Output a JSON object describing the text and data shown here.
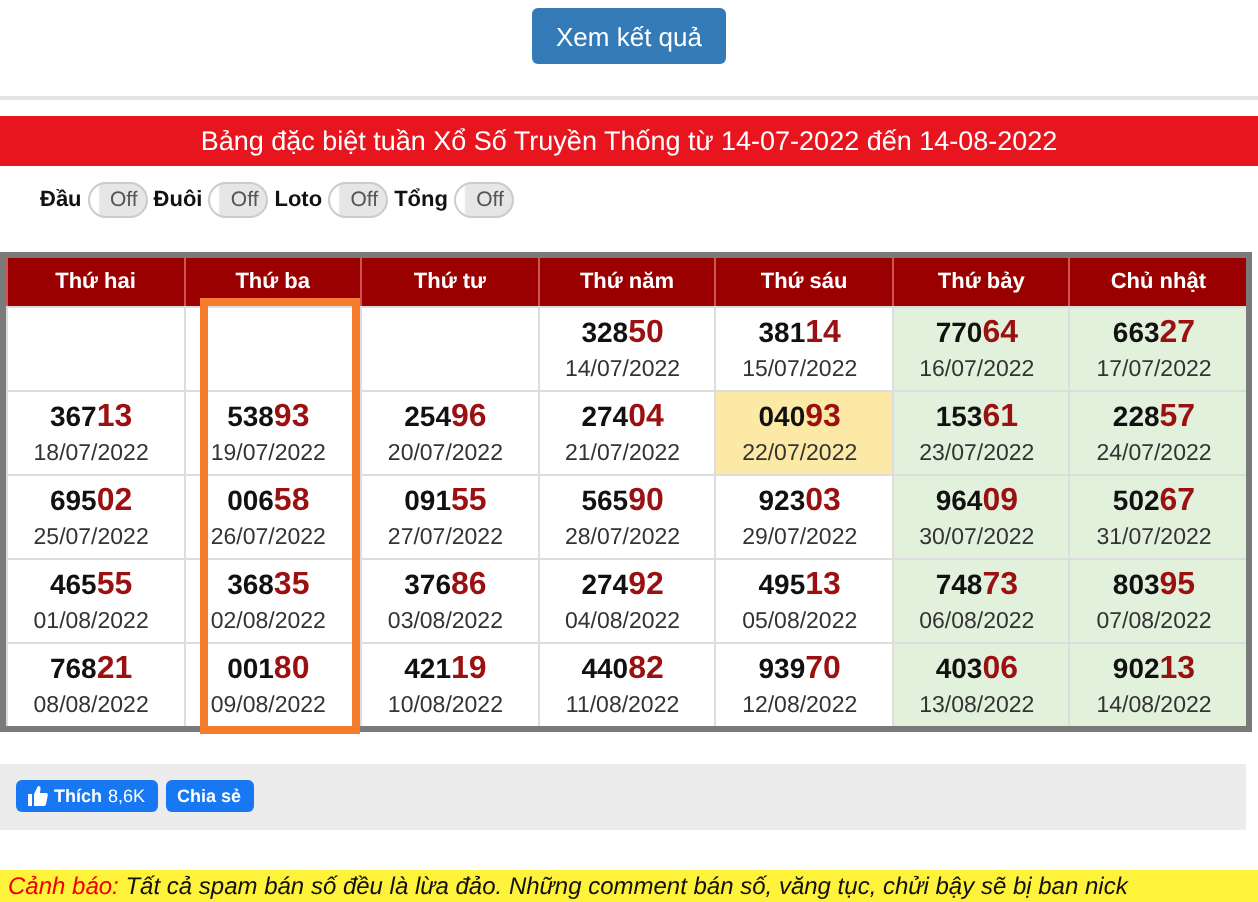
{
  "submit_button": {
    "label": "Xem kết quả"
  },
  "banner": {
    "title": "Bảng đặc biệt tuần Xổ Số Truyền Thống từ 14-07-2022 đến 14-08-2022"
  },
  "toggles": [
    {
      "label": "Đầu",
      "text": "Off",
      "on": false
    },
    {
      "label": "Đuôi",
      "text": "Off",
      "on": false
    },
    {
      "label": "Loto",
      "text": "Off",
      "on": false
    },
    {
      "label": "Tổng",
      "text": "Off",
      "on": false
    }
  ],
  "table": {
    "columns": [
      {
        "label": "Thứ hai",
        "weekend": false,
        "marked": false
      },
      {
        "label": "Thứ ba",
        "weekend": false,
        "marked": true
      },
      {
        "label": "Thứ tư",
        "weekend": false,
        "marked": false
      },
      {
        "label": "Thứ năm",
        "weekend": false,
        "marked": false
      },
      {
        "label": "Thứ sáu",
        "weekend": false,
        "marked": false
      },
      {
        "label": "Thứ bảy",
        "weekend": true,
        "marked": false
      },
      {
        "label": "Chủ nhật",
        "weekend": true,
        "marked": false
      }
    ],
    "rows": [
      [
        {
          "empty": true
        },
        {
          "empty": true
        },
        {
          "empty": true
        },
        {
          "head": "328",
          "tail": "50",
          "date": "14/07/2022",
          "highlighted": false
        },
        {
          "head": "381",
          "tail": "14",
          "date": "15/07/2022",
          "highlighted": false
        },
        {
          "head": "770",
          "tail": "64",
          "date": "16/07/2022",
          "highlighted": false
        },
        {
          "head": "663",
          "tail": "27",
          "date": "17/07/2022",
          "highlighted": false
        }
      ],
      [
        {
          "head": "367",
          "tail": "13",
          "date": "18/07/2022",
          "highlighted": false
        },
        {
          "head": "538",
          "tail": "93",
          "date": "19/07/2022",
          "highlighted": false
        },
        {
          "head": "254",
          "tail": "96",
          "date": "20/07/2022",
          "highlighted": false
        },
        {
          "head": "274",
          "tail": "04",
          "date": "21/07/2022",
          "highlighted": false
        },
        {
          "head": "040",
          "tail": "93",
          "date": "22/07/2022",
          "highlighted": true
        },
        {
          "head": "153",
          "tail": "61",
          "date": "23/07/2022",
          "highlighted": false
        },
        {
          "head": "228",
          "tail": "57",
          "date": "24/07/2022",
          "highlighted": false
        }
      ],
      [
        {
          "head": "695",
          "tail": "02",
          "date": "25/07/2022",
          "highlighted": false
        },
        {
          "head": "006",
          "tail": "58",
          "date": "26/07/2022",
          "highlighted": false
        },
        {
          "head": "091",
          "tail": "55",
          "date": "27/07/2022",
          "highlighted": false
        },
        {
          "head": "565",
          "tail": "90",
          "date": "28/07/2022",
          "highlighted": false
        },
        {
          "head": "923",
          "tail": "03",
          "date": "29/07/2022",
          "highlighted": false
        },
        {
          "head": "964",
          "tail": "09",
          "date": "30/07/2022",
          "highlighted": false
        },
        {
          "head": "502",
          "tail": "67",
          "date": "31/07/2022",
          "highlighted": false
        }
      ],
      [
        {
          "head": "465",
          "tail": "55",
          "date": "01/08/2022",
          "highlighted": false
        },
        {
          "head": "368",
          "tail": "35",
          "date": "02/08/2022",
          "highlighted": false
        },
        {
          "head": "376",
          "tail": "86",
          "date": "03/08/2022",
          "highlighted": false
        },
        {
          "head": "274",
          "tail": "92",
          "date": "04/08/2022",
          "highlighted": false
        },
        {
          "head": "495",
          "tail": "13",
          "date": "05/08/2022",
          "highlighted": false
        },
        {
          "head": "748",
          "tail": "73",
          "date": "06/08/2022",
          "highlighted": false
        },
        {
          "head": "803",
          "tail": "95",
          "date": "07/08/2022",
          "highlighted": false
        }
      ],
      [
        {
          "head": "768",
          "tail": "21",
          "date": "08/08/2022",
          "highlighted": false
        },
        {
          "head": "001",
          "tail": "80",
          "date": "09/08/2022",
          "highlighted": false
        },
        {
          "head": "421",
          "tail": "19",
          "date": "10/08/2022",
          "highlighted": false
        },
        {
          "head": "440",
          "tail": "82",
          "date": "11/08/2022",
          "highlighted": false
        },
        {
          "head": "939",
          "tail": "70",
          "date": "12/08/2022",
          "highlighted": false
        },
        {
          "head": "403",
          "tail": "06",
          "date": "13/08/2022",
          "highlighted": false
        },
        {
          "head": "902",
          "tail": "13",
          "date": "14/08/2022",
          "highlighted": false
        }
      ]
    ]
  },
  "social": {
    "like_label": "Thích",
    "like_count": "8,6K",
    "share_label": "Chia sẻ"
  },
  "warning": {
    "text": "*Cảnh báo:* Tất cả spam bán số đều là lừa đảo. Những comment bán số, văng tục, chửi bậy sẽ bị ban nick"
  }
}
